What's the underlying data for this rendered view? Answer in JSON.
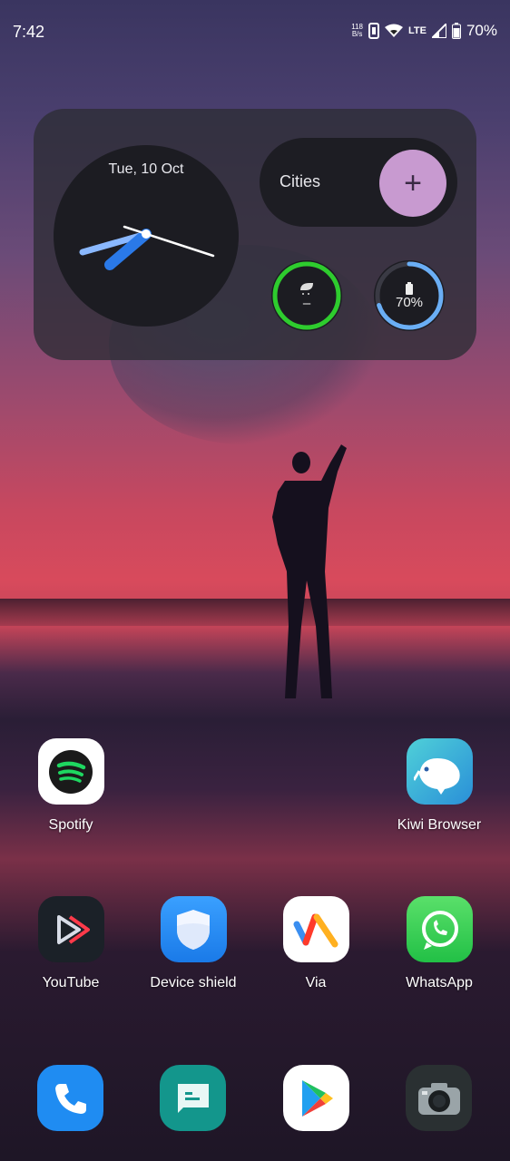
{
  "status_bar": {
    "time": "7:42",
    "net_speed_value": "118",
    "net_speed_unit": "B/s",
    "network_type": "LTE",
    "battery_percent": "70%",
    "icons": [
      "net-speed-icon",
      "vibrate-icon",
      "wifi-icon",
      "signal-icon",
      "battery-icon"
    ]
  },
  "widget": {
    "clock_date": "Tue, 10 Oct",
    "cities_label": "Cities",
    "add_symbol": "+",
    "weather_value": "–",
    "battery_ring_value": "70%",
    "battery_level": 0.7,
    "colors": {
      "green_ring": "#2ecc2e",
      "blue_ring": "#6aaef5",
      "add_button": "#c89ad0"
    }
  },
  "apps": {
    "row1": [
      {
        "label": "Spotify",
        "icon": "spotify-icon"
      },
      {
        "label": "Kiwi Browser",
        "icon": "kiwi-icon"
      }
    ],
    "row2": [
      {
        "label": "YouTube",
        "icon": "youtube-icon"
      },
      {
        "label": "Device shield",
        "icon": "shield-icon"
      },
      {
        "label": "Via",
        "icon": "via-icon"
      },
      {
        "label": "WhatsApp",
        "icon": "whatsapp-icon"
      }
    ]
  },
  "dock": [
    {
      "icon": "phone-icon"
    },
    {
      "icon": "messages-icon"
    },
    {
      "icon": "play-store-icon"
    },
    {
      "icon": "camera-icon"
    }
  ]
}
